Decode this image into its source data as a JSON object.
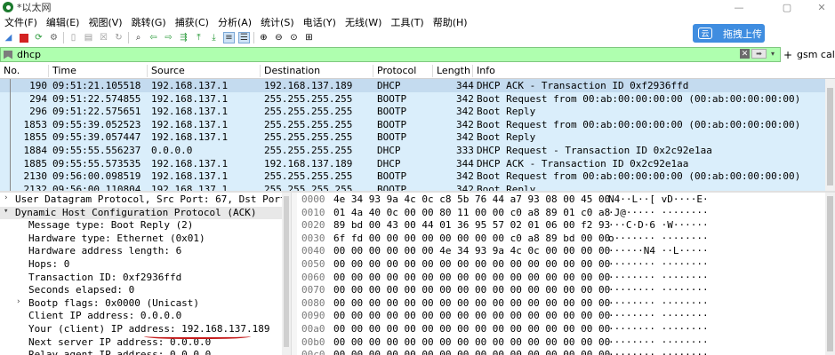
{
  "window": {
    "title": "*以太网",
    "controls": {
      "minimize": "—",
      "maximize": "▢",
      "close": "✕"
    }
  },
  "menu": [
    "文件(F)",
    "编辑(E)",
    "视图(V)",
    "跳转(G)",
    "捕获(C)",
    "分析(A)",
    "统计(S)",
    "电话(Y)",
    "无线(W)",
    "工具(T)",
    "帮助(H)"
  ],
  "upload_button": {
    "label": "拖拽上传",
    "icon": "云"
  },
  "filter": {
    "value": "dhcp",
    "right_label": "gsm call"
  },
  "columns": [
    "No.",
    "Time",
    "Source",
    "Destination",
    "Protocol",
    "Length",
    "Info"
  ],
  "packets": [
    {
      "no": "190",
      "time": "09:51:21.105518",
      "src": "192.168.137.1",
      "dst": "192.168.137.189",
      "proto": "DHCP",
      "len": "344",
      "info": "DHCP ACK      - Transaction ID 0xf2936ffd"
    },
    {
      "no": "294",
      "time": "09:51:22.574855",
      "src": "192.168.137.1",
      "dst": "255.255.255.255",
      "proto": "BOOTP",
      "len": "342",
      "info": "Boot Request from 00:ab:00:00:00:00 (00:ab:00:00:00:00)"
    },
    {
      "no": "296",
      "time": "09:51:22.575651",
      "src": "192.168.137.1",
      "dst": "255.255.255.255",
      "proto": "BOOTP",
      "len": "342",
      "info": "Boot Reply"
    },
    {
      "no": "1853",
      "time": "09:55:39.052523",
      "src": "192.168.137.1",
      "dst": "255.255.255.255",
      "proto": "BOOTP",
      "len": "342",
      "info": "Boot Request from 00:ab:00:00:00:00 (00:ab:00:00:00:00)"
    },
    {
      "no": "1855",
      "time": "09:55:39.057447",
      "src": "192.168.137.1",
      "dst": "255.255.255.255",
      "proto": "BOOTP",
      "len": "342",
      "info": "Boot Reply"
    },
    {
      "no": "1884",
      "time": "09:55:55.556237",
      "src": "0.0.0.0",
      "dst": "255.255.255.255",
      "proto": "DHCP",
      "len": "333",
      "info": "DHCP Request  - Transaction ID 0x2c92e1aa"
    },
    {
      "no": "1885",
      "time": "09:55:55.573535",
      "src": "192.168.137.1",
      "dst": "192.168.137.189",
      "proto": "DHCP",
      "len": "344",
      "info": "DHCP ACK      - Transaction ID 0x2c92e1aa"
    },
    {
      "no": "2130",
      "time": "09:56:00.098519",
      "src": "192.168.137.1",
      "dst": "255.255.255.255",
      "proto": "BOOTP",
      "len": "342",
      "info": "Boot Request from 00:ab:00:00:00:00 (00:ab:00:00:00:00)"
    },
    {
      "no": "2132",
      "time": "09:56:00.110804",
      "src": "192.168.137.1",
      "dst": "255.255.255.255",
      "proto": "BOOTP",
      "len": "342",
      "info": "Boot Reply"
    }
  ],
  "details": [
    {
      "text": "User Datagram Protocol, Src Port: 67, Dst Port: 68",
      "arrow": ">",
      "indent": 0
    },
    {
      "text": "Dynamic Host Configuration Protocol (ACK)",
      "arrow": "v",
      "indent": 0
    },
    {
      "text": "Message type: Boot Reply (2)",
      "arrow": "",
      "indent": 1
    },
    {
      "text": "Hardware type: Ethernet (0x01)",
      "arrow": "",
      "indent": 1
    },
    {
      "text": "Hardware address length: 6",
      "arrow": "",
      "indent": 1
    },
    {
      "text": "Hops: 0",
      "arrow": "",
      "indent": 1
    },
    {
      "text": "Transaction ID: 0xf2936ffd",
      "arrow": "",
      "indent": 1
    },
    {
      "text": "Seconds elapsed: 0",
      "arrow": "",
      "indent": 1
    },
    {
      "text": "Bootp flags: 0x0000 (Unicast)",
      "arrow": ">",
      "indent": 1
    },
    {
      "text": "Client IP address: 0.0.0.0",
      "arrow": "",
      "indent": 1
    },
    {
      "text": "Your (client) IP address: 192.168.137.189",
      "arrow": "",
      "indent": 1
    },
    {
      "text": "Next server IP address: 0.0.0.0",
      "arrow": "",
      "indent": 1
    },
    {
      "text": "Relay agent IP address: 0.0.0.0",
      "arrow": "",
      "indent": 1
    }
  ],
  "hex": [
    {
      "off": "0000",
      "hex": "4e 34 93 9a 4c 0c c8 5b  76 44 a7 93 08 00 45 00",
      "asc": "N4··L··[ vD····E·"
    },
    {
      "off": "0010",
      "hex": "01 4a 40 0c 00 00 80 11  00 00 c0 a8 89 01 c0 a8",
      "asc": "·J@·····  ········"
    },
    {
      "off": "0020",
      "hex": "89 bd 00 43 00 44 01 36  95 57 02 01 06 00 f2 93",
      "asc": "···C·D·6 ·W······"
    },
    {
      "off": "0030",
      "hex": "6f fd 00 00 00 00 00 00  00 00 c0 a8 89 bd 00 00",
      "asc": "o······· ········"
    },
    {
      "off": "0040",
      "hex": "00 00 00 00 00 00 4e 34  93 9a 4c 0c 00 00 00 00",
      "asc": "······N4 ··L·····"
    },
    {
      "off": "0050",
      "hex": "00 00 00 00 00 00 00 00  00 00 00 00 00 00 00 00",
      "asc": "········ ········"
    },
    {
      "off": "0060",
      "hex": "00 00 00 00 00 00 00 00  00 00 00 00 00 00 00 00",
      "asc": "········ ········"
    },
    {
      "off": "0070",
      "hex": "00 00 00 00 00 00 00 00  00 00 00 00 00 00 00 00",
      "asc": "········ ········"
    },
    {
      "off": "0080",
      "hex": "00 00 00 00 00 00 00 00  00 00 00 00 00 00 00 00",
      "asc": "········ ········"
    },
    {
      "off": "0090",
      "hex": "00 00 00 00 00 00 00 00  00 00 00 00 00 00 00 00",
      "asc": "········ ········"
    },
    {
      "off": "00a0",
      "hex": "00 00 00 00 00 00 00 00  00 00 00 00 00 00 00 00",
      "asc": "········ ········"
    },
    {
      "off": "00b0",
      "hex": "00 00 00 00 00 00 00 00  00 00 00 00 00 00 00 00",
      "asc": "········ ········"
    },
    {
      "off": "00c0",
      "hex": "00 00 00 00 00 00 00 00  00 00 00 00 00 00 00 00",
      "asc": "········ ········"
    }
  ],
  "colors": {
    "filter_bg": "#afffaf",
    "row_bg": "#daeefb",
    "selected_row_bg": "#c4dbef",
    "upload_bg": "#3f8de0",
    "annotation": "#c41a1a"
  }
}
